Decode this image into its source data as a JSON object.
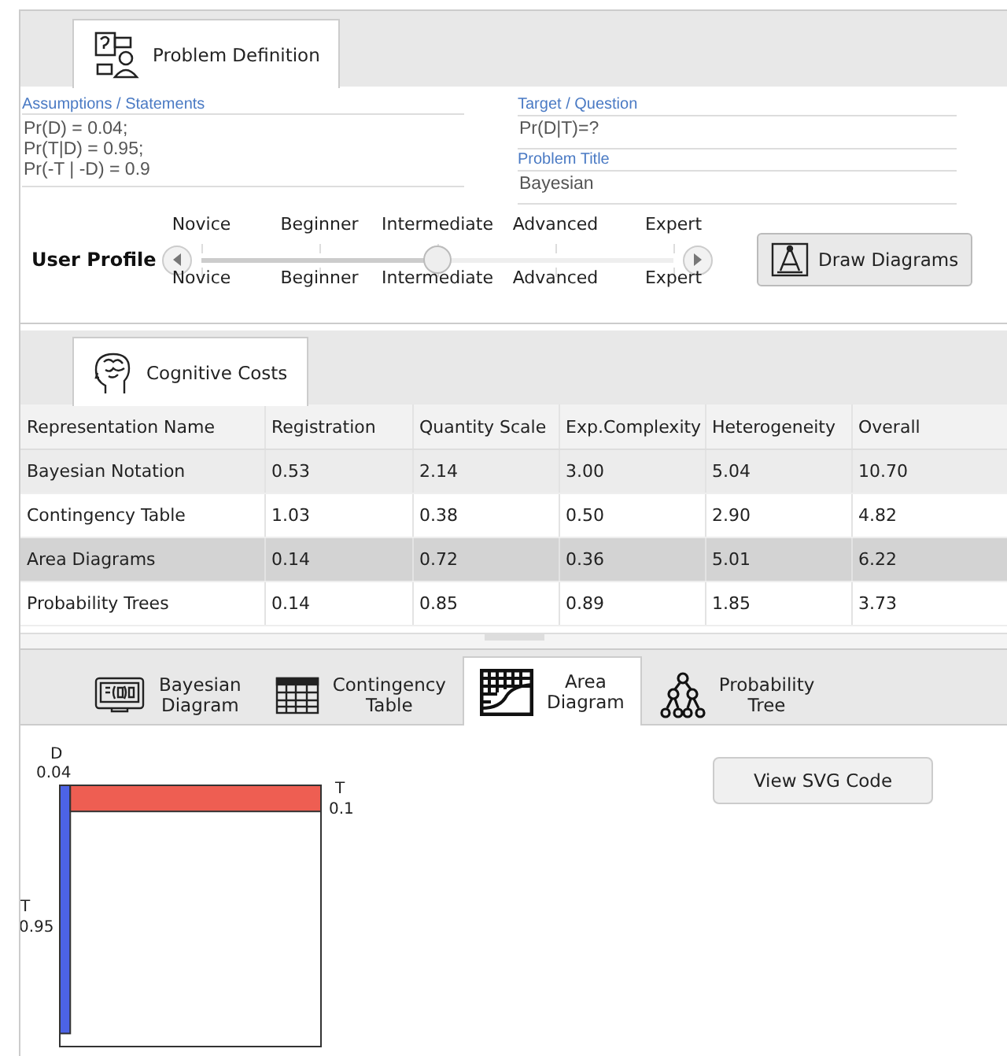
{
  "problem_tabs": [
    {
      "label": "Problem Definition",
      "selected": true
    }
  ],
  "assumptions": {
    "label": "Assumptions / Statements",
    "lines": [
      "Pr(D) = 0.04;",
      "Pr(T|D) = 0.95;",
      "Pr(-T | -D) = 0.9"
    ]
  },
  "target": {
    "label": "Target / Question",
    "value": "Pr(D|T)=?"
  },
  "problem_title": {
    "label": "Problem Title",
    "value": "Bayesian"
  },
  "user_profile": {
    "label": "User Profile",
    "levels_top": [
      "Novice",
      "Beginner",
      "Intermediate",
      "Advanced",
      "Expert"
    ],
    "levels_bottom": [
      "Novice",
      "Beginner",
      "Intermediate",
      "Advanced",
      "Expert"
    ],
    "level": 0.5
  },
  "draw_button": "Draw Diagrams",
  "cost_tabs": [
    {
      "label": "Cognitive Costs",
      "selected": true
    }
  ],
  "table": {
    "columns": [
      "Representation Name",
      "Registration",
      "Quantity Scale",
      "Exp.Complexity",
      "Heterogeneity",
      "Overall"
    ],
    "rows": [
      {
        "cells": [
          "Bayesian Notation",
          "0.53",
          "2.14",
          "3.00",
          "5.04",
          "10.70"
        ],
        "selected": false,
        "hovered": true
      },
      {
        "cells": [
          "Contingency Table",
          "1.03",
          "0.38",
          "0.50",
          "2.90",
          "4.82"
        ],
        "selected": false,
        "hovered": false
      },
      {
        "cells": [
          "Area Diagrams",
          "0.14",
          "0.72",
          "0.36",
          "5.01",
          "6.22"
        ],
        "selected": true,
        "hovered": false
      },
      {
        "cells": [
          "Probability Trees",
          "0.14",
          "0.85",
          "0.89",
          "1.85",
          "3.73"
        ],
        "selected": false,
        "hovered": false
      }
    ]
  },
  "diagram_tabs": [
    {
      "kind": "bayesian",
      "label": "Bayesian\nDiagram",
      "selected": false
    },
    {
      "kind": "table",
      "label": "Contingency\nTable",
      "selected": false
    },
    {
      "kind": "area",
      "label": "Area\nDiagram",
      "selected": true
    },
    {
      "kind": "tree",
      "label": "Probability\nTree",
      "selected": false
    }
  ],
  "area_diagram": {
    "d_name": "D",
    "d_value": "0.04",
    "t_name": "T",
    "t_value": "0.95",
    "ft_name": "T",
    "ft_value": "0.1"
  },
  "svg_button": "View SVG Code"
}
